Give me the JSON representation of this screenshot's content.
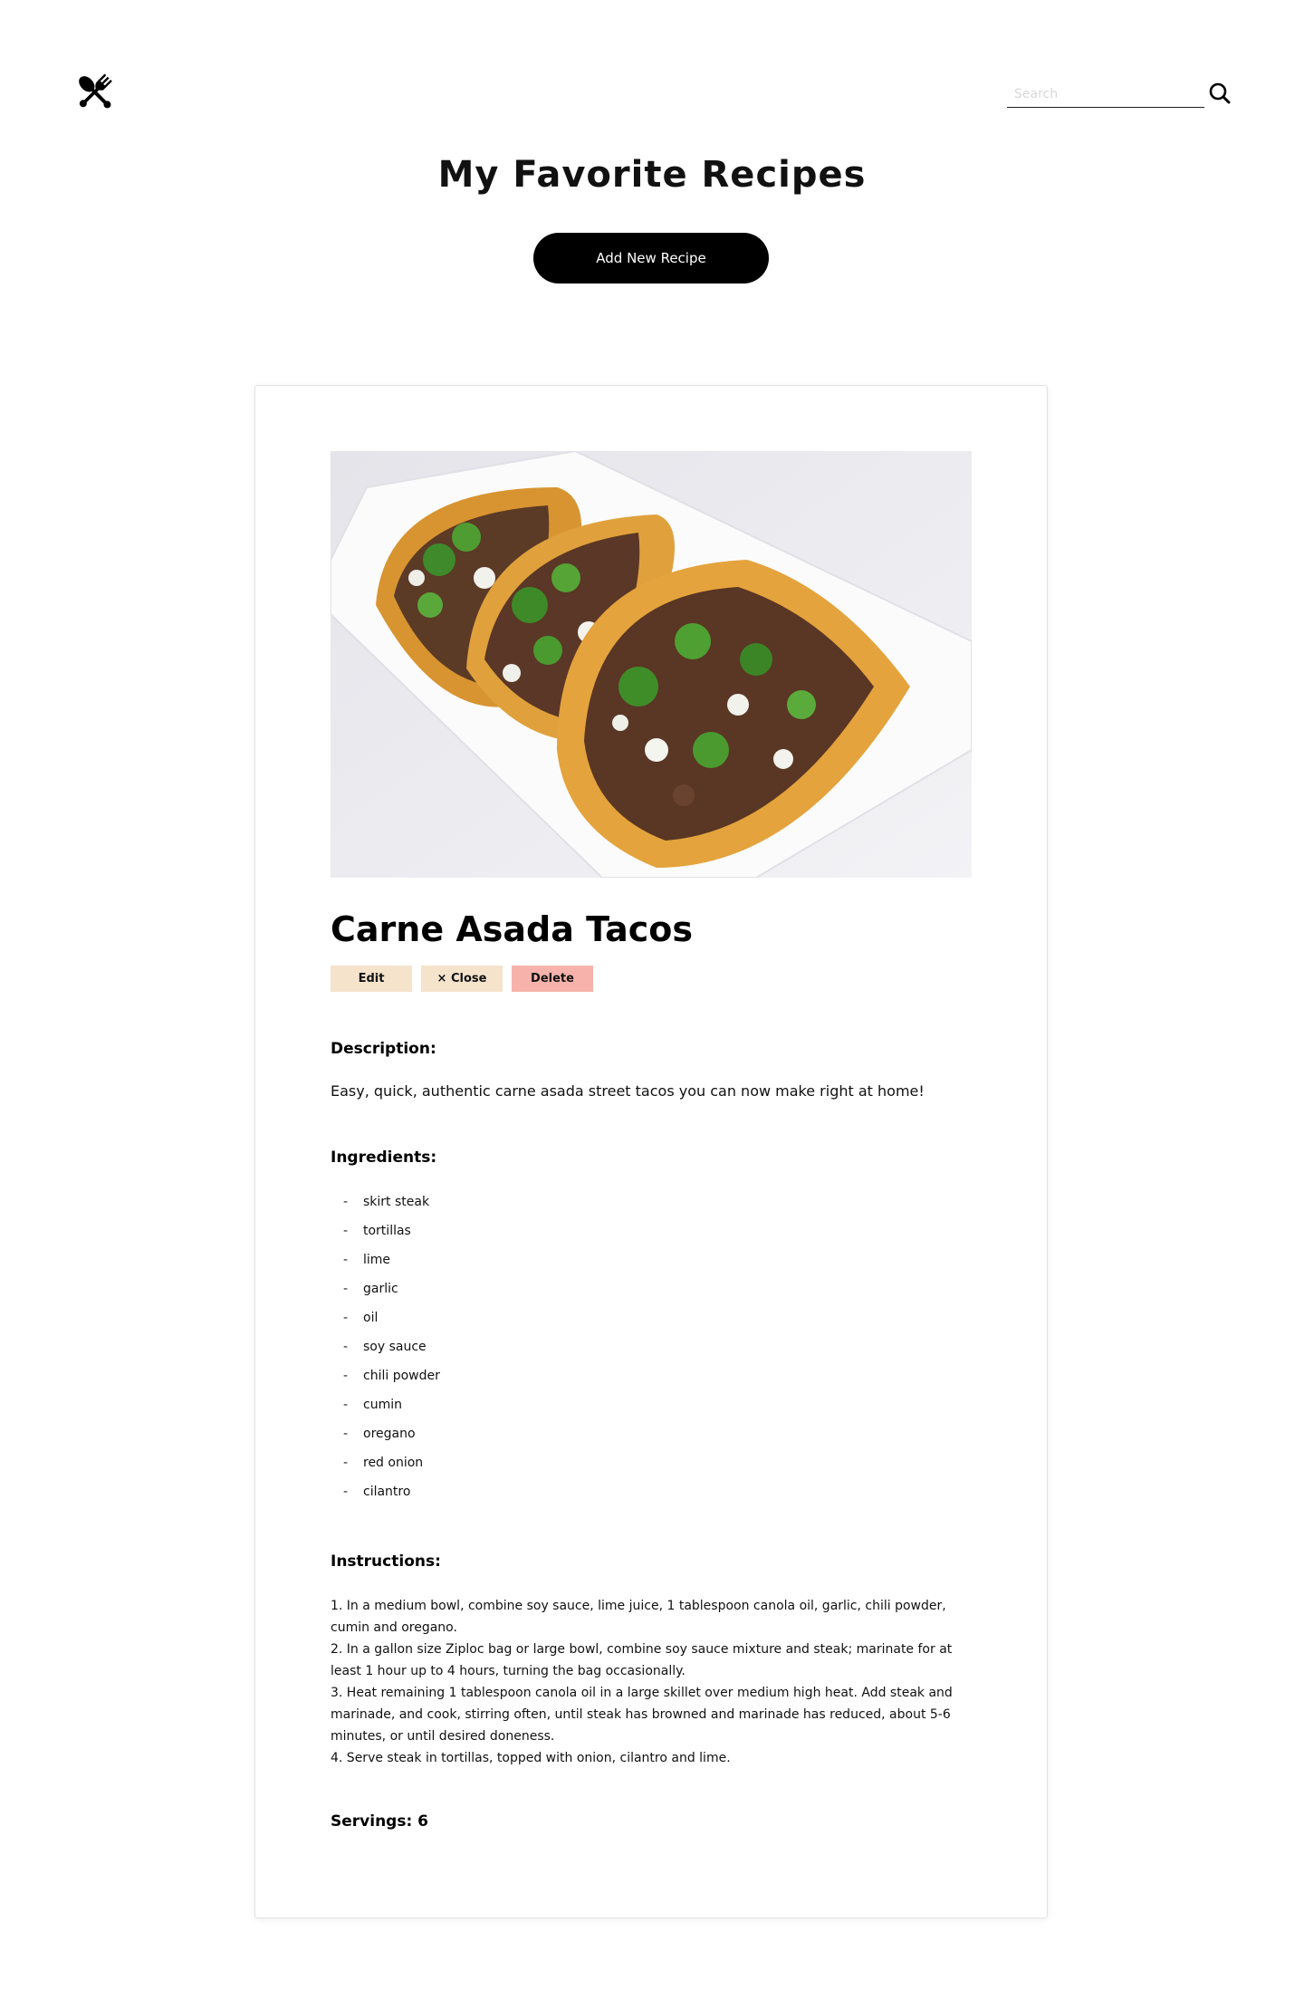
{
  "header": {
    "search_placeholder": "Search"
  },
  "icons": {
    "logo": "crossed-spoon-fork-icon",
    "search": "search-icon"
  },
  "page": {
    "title": "My Favorite Recipes",
    "add_button_label": "Add New Recipe"
  },
  "recipe": {
    "name": "Carne Asada Tacos",
    "actions": {
      "edit": "Edit",
      "close": "× Close",
      "delete": "Delete"
    },
    "description_heading": "Description:",
    "description": "Easy, quick, authentic carne asada street tacos you can now make right at home!",
    "ingredients_heading": "Ingredients:",
    "ingredients": [
      "skirt steak",
      "tortillas",
      "lime",
      "garlic",
      "oil",
      "soy sauce",
      "chili powder",
      "cumin",
      "oregano",
      "red onion",
      "cilantro"
    ],
    "instructions_heading": "Instructions:",
    "instructions": [
      "1. In a medium bowl, combine soy sauce, lime juice, 1 tablespoon canola oil, garlic, chili powder, cumin and oregano.",
      "2. In a gallon size Ziploc bag or large bowl, combine soy sauce mixture and steak; marinate for at least 1 hour up to 4 hours, turning the bag occasionally.",
      "3. Heat remaining 1 tablespoon canola oil in a large skillet over medium high heat. Add steak and marinade, and cook, stirring often, until steak has browned and marinade has reduced, about 5-6 minutes, or until desired doneness.",
      "4. Serve steak in tortillas, topped with onion, cilantro and lime."
    ],
    "servings": "Servings: 6"
  },
  "colors": {
    "edit_bg": "#f5e3cc",
    "close_bg": "#f5e3cc",
    "delete_bg": "#f7b3ab",
    "primary_button_bg": "#000000"
  }
}
